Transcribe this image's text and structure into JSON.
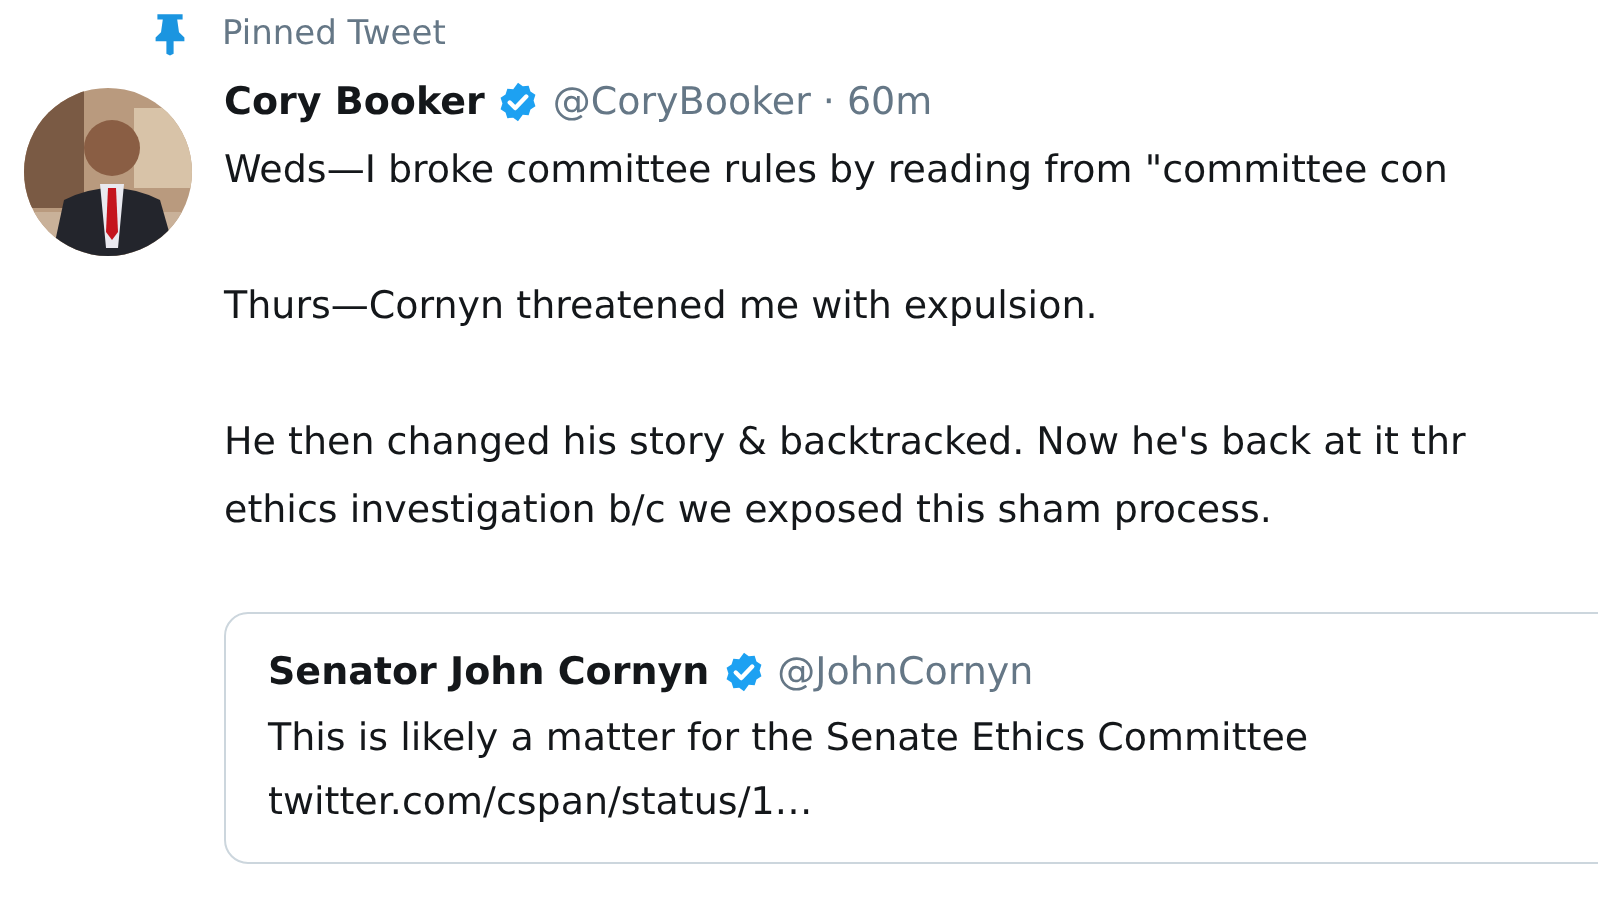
{
  "pinned": {
    "label": "Pinned Tweet"
  },
  "tweet": {
    "author": {
      "name": "Cory Booker",
      "verified": true,
      "handle": "@CoryBooker",
      "dot": "·",
      "time": "60m"
    },
    "paragraphs": [
      {
        "lines": [
          "Weds—I broke committee rules by reading from \"committee con"
        ]
      },
      {
        "lines": [
          "Thurs—Cornyn threatened me with expulsion."
        ]
      },
      {
        "lines": [
          "He then changed his story & backtracked. Now he's back at it thr",
          "ethics investigation b/c we exposed this sham process."
        ]
      }
    ],
    "quote": {
      "author": {
        "name": "Senator John Cornyn",
        "verified": true,
        "handle": "@JohnCornyn"
      },
      "lines": [
        "This is likely a matter for the Senate Ethics Committee",
        "twitter.com/cspan/status/1…"
      ]
    }
  }
}
